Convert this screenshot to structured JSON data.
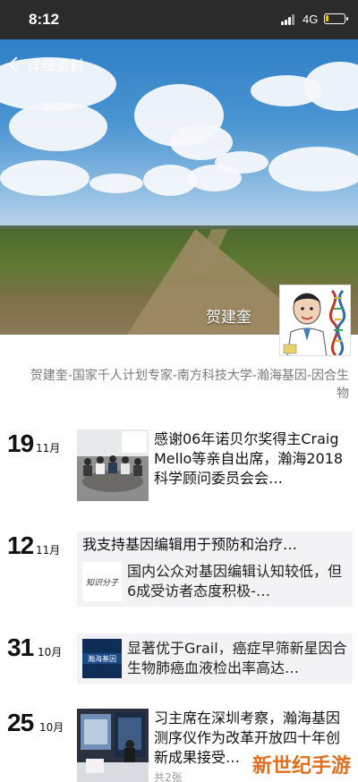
{
  "status_bar": {
    "time": "8:12",
    "network": "4G",
    "battery_level": 0.15,
    "battery_color": "#f5c400"
  },
  "nav": {
    "back_icon": "chevron-left-icon",
    "back_label": "详细资料"
  },
  "profile": {
    "name": "贺建奎",
    "signature": "贺建奎-国家千人计划专家-南方科技大学-瀚海基因-因合生物"
  },
  "posts": [
    {
      "day": "19",
      "month": "11月",
      "text": "感谢06年诺贝尔奖得主Craig Mello等亲自出席，瀚海2018科学顾问委员会会…"
    },
    {
      "day": "12",
      "month": "11月",
      "comment": "我支持基因编辑用于预防和治疗…",
      "shared_text": "国内公众对基因编辑认知较低，但6成受访者态度积极-…"
    },
    {
      "day": "31",
      "month": "10月",
      "shared_text": "显著优于Grail，癌症早筛新星因合生物肺癌血液检出率高达…",
      "shared_logo": "瀚海基因"
    },
    {
      "day": "25",
      "month": "10月",
      "text": "习主席在深圳考察，瀚海基因测序仪作为改革开放四十年创新成果接受…",
      "image_count": "共2张"
    }
  ],
  "watermark": "新世纪手游"
}
